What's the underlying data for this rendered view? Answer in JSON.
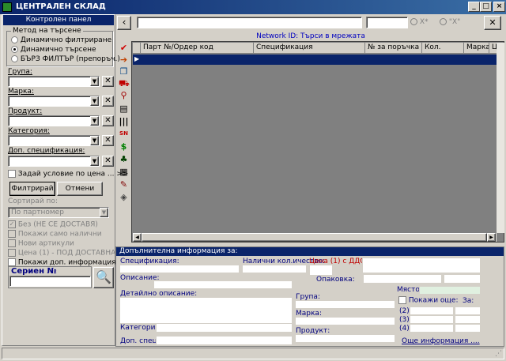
{
  "window": {
    "title": "ЦЕНТРАЛЕН СКЛАД"
  },
  "left_panel": {
    "header": "Контролен панел",
    "search_method": {
      "label": "Метод на търсене",
      "options": [
        "Динамично филтриране",
        "Динамично търсене",
        "БЪРЗ ФИЛТЪР (препоръч.)"
      ],
      "selected": "Динамично търсене"
    },
    "filters": [
      {
        "label": "Група:",
        "value": ""
      },
      {
        "label": "Марка:",
        "value": ""
      },
      {
        "label": "Продукт:",
        "value": ""
      },
      {
        "label": "Категория:",
        "value": ""
      },
      {
        "label": "Доп. спецификация:",
        "value": ""
      }
    ],
    "price_condition": "Задай условие по цена ...",
    "price_more": ">>",
    "filter_button": "Филтрирай",
    "cancel_button": "Отмени",
    "sort_label": "Сортирай по:",
    "sort_value": "По партномер",
    "checkboxes": [
      {
        "label": "Без (НЕ СЕ ДОСТАВЯ)",
        "checked": true,
        "enabled": false
      },
      {
        "label": "Покажи само налични",
        "checked": false,
        "enabled": false
      },
      {
        "label": "Нови артикули",
        "checked": false,
        "enabled": false
      },
      {
        "label": "Цена (1) - ПОД ДОСТАВНА",
        "checked": false,
        "enabled": false
      },
      {
        "label": "Покажи доп. информация",
        "checked": false,
        "enabled": true
      }
    ],
    "serial_label": "Сериен №",
    "serial_value": ""
  },
  "toolbar": {
    "back": "‹",
    "close": "✕",
    "search_value": "",
    "radio_x": "\"X\"",
    "radio_x_star": "X*"
  },
  "network_id": "Network ID: Търси в мрежата",
  "grid": {
    "columns": [
      "",
      "Парт №/Ордер код",
      "Спецификация",
      "№ за поръчка",
      "Кол.",
      "Марка",
      "Цен"
    ]
  },
  "icons": [
    "check-icon",
    "forward-icon",
    "copy-icon",
    "cart-icon",
    "search-icon",
    "document-icon",
    "barcode-icon",
    "sn-icon",
    "dollar-icon",
    "tree-icon",
    "clipboard-icon",
    "edit-icon",
    "tag-icon"
  ],
  "info": {
    "header": "Допълнителна информация за:",
    "spec_label": "Спецификация:",
    "available_qty_label": "Налични кол.ичество:",
    "price_vat_label": "Цена (1) с ДДС:",
    "description_label": "Описание:",
    "package_label": "Опаковка:",
    "detailed_description_label": "Детайлно описание:",
    "location_label": "Място:",
    "group_label": "Група:",
    "show_also_label": "Покажи още:",
    "for_label": "За:",
    "brand_label": "Марка:",
    "product_label": "Продукт:",
    "alt2": "(2)",
    "alt3": "(3)",
    "alt4": "(4)",
    "category_label": "Категория:",
    "extra_spec_label": "Доп. спец.:",
    "more_info_link": "Още информация ...."
  }
}
